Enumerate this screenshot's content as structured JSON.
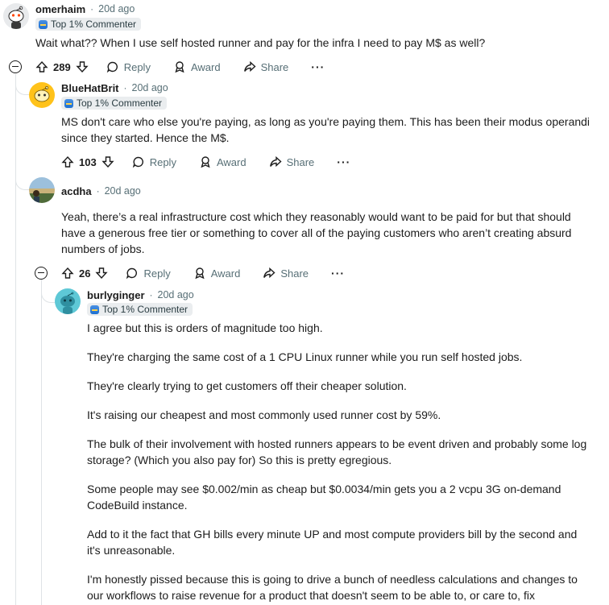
{
  "comments": [
    {
      "username": "omerhaim",
      "time": "20d ago",
      "flair": "Top 1% Commenter",
      "body": [
        "Wait what?? When I use self hosted runner and pay for the infra I need to pay M$ as well?"
      ],
      "votes": "289"
    },
    {
      "username": "BlueHatBrit",
      "time": "20d ago",
      "flair": "Top 1% Commenter",
      "body": [
        "MS don't care who else you're paying, as long as you're paying them. This has been their modus operandi since they started. Hence the M$."
      ],
      "votes": "103"
    },
    {
      "username": "acdha",
      "time": "20d ago",
      "body": [
        "Yeah, there’s a real infrastructure cost which they reasonably would want to be paid for but that should have a generous free tier or something to cover all of the paying customers who aren’t creating absurd numbers of jobs."
      ],
      "votes": "26"
    },
    {
      "username": "burlyginger",
      "time": "20d ago",
      "flair": "Top 1% Commenter",
      "body": [
        "I agree but this is orders of magnitude too high.",
        "They're charging the same cost of a 1 CPU Linux runner while you run self hosted jobs.",
        "They're clearly trying to get customers off their cheaper solution.",
        "It's raising our cheapest and most commonly used runner cost by 59%.",
        "The bulk of their involvement with hosted runners appears to be event driven and probably some log storage? (Which you also pay for) So this is pretty egregious.",
        "Some people may see $0.002/min as cheap but $0.0034/min gets you a 2 vcpu 3G on-demand CodeBuild instance.",
        "Add to it the fact that GH bills every minute UP and most compute providers bill by the second and it's unreasonable.",
        "I'm honestly pissed because this is going to drive a bunch of needless calculations and changes to our workflows to raise revenue for a product that doesn't seem to be able to, or care to, fix"
      ]
    }
  ],
  "actions": {
    "reply": "Reply",
    "award": "Award",
    "share": "Share",
    "more": "···"
  },
  "separator": "·"
}
